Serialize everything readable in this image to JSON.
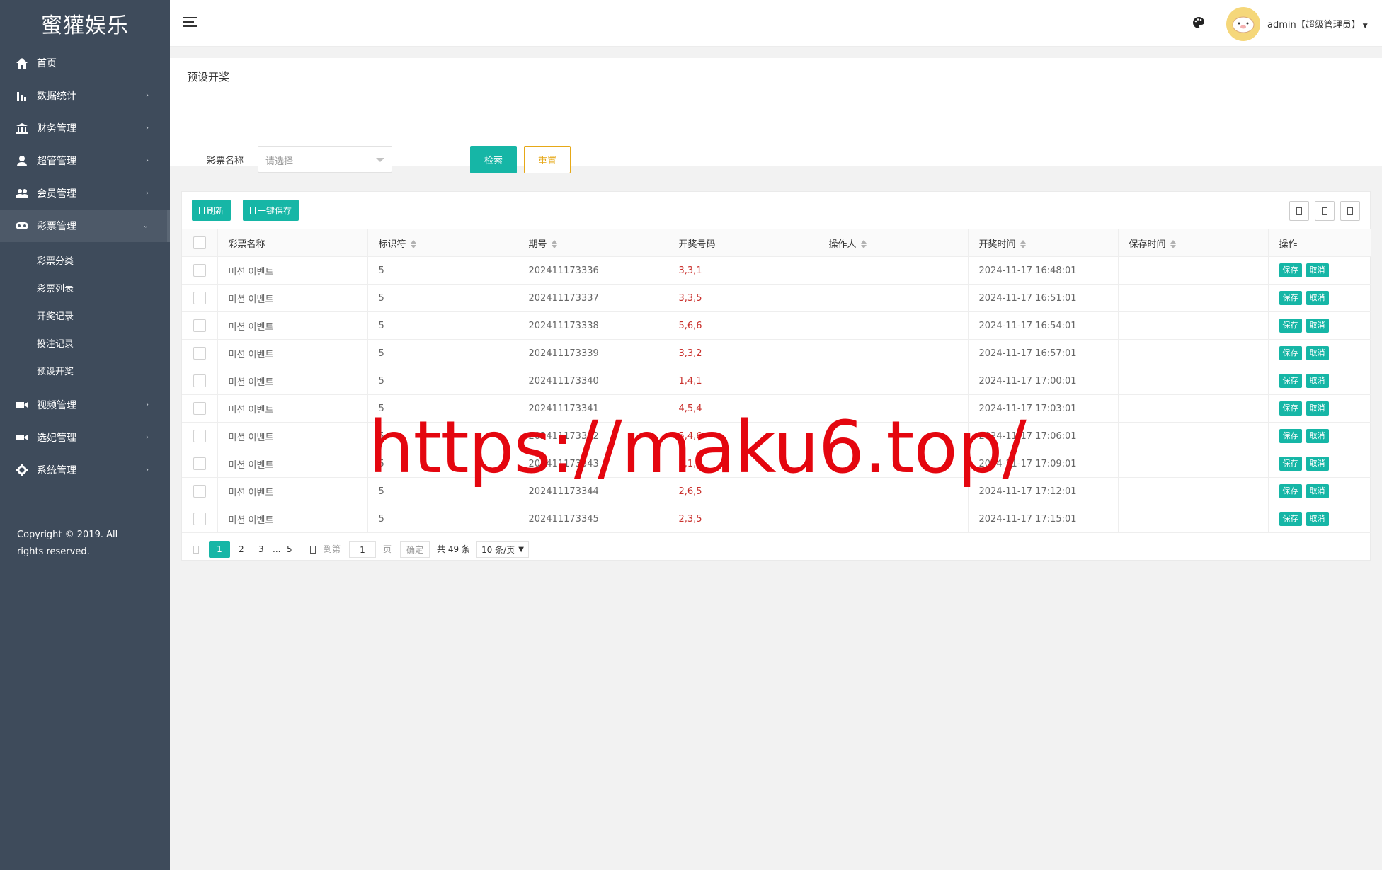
{
  "app": {
    "title": "蜜獾娱乐"
  },
  "sidebar": {
    "items": [
      {
        "label": "首页",
        "icon": "home-icon",
        "has_children": false
      },
      {
        "label": "数据统计",
        "icon": "bar-chart-icon",
        "has_children": true
      },
      {
        "label": "财务管理",
        "icon": "bank-icon",
        "has_children": true
      },
      {
        "label": "超管管理",
        "icon": "user-icon",
        "has_children": true
      },
      {
        "label": "会员管理",
        "icon": "users-icon",
        "has_children": true
      },
      {
        "label": "彩票管理",
        "icon": "gamepad-icon",
        "has_children": true,
        "active": true
      }
    ],
    "sub_items": [
      "彩票分类",
      "彩票列表",
      "开奖记录",
      "投注记录",
      "预设开奖"
    ],
    "items_after": [
      {
        "label": "视频管理",
        "icon": "video-icon",
        "has_children": true
      },
      {
        "label": "选妃管理",
        "icon": "video-icon",
        "has_children": true
      },
      {
        "label": "系统管理",
        "icon": "gear-icon",
        "has_children": true
      }
    ],
    "copyright": "Copyright © 2019. All rights reserved."
  },
  "header": {
    "user_label": "admin【超级管理员】",
    "icons": [
      "menu-icon",
      "palette-icon"
    ]
  },
  "search": {
    "title": "预设开奖",
    "field_label": "彩票名称",
    "select_placeholder": "请选择",
    "search_button": "检索",
    "reset_button": "重置"
  },
  "toolbar": {
    "refresh_label": "刷新",
    "save_all_label": "一键保存"
  },
  "table": {
    "columns": [
      "彩票名称",
      "标识符",
      "期号",
      "开奖号码",
      "操作人",
      "开奖时间",
      "保存时间",
      "操作"
    ],
    "sortable": [
      false,
      true,
      true,
      false,
      true,
      true,
      true,
      false
    ],
    "rows": [
      {
        "name": "미션 이벤트",
        "key": "5",
        "issue": "202411173336",
        "numbers": "3,3,1",
        "operator": "",
        "draw_time": "2024-11-17 16:48:01",
        "save_time": ""
      },
      {
        "name": "미션 이벤트",
        "key": "5",
        "issue": "202411173337",
        "numbers": "3,3,5",
        "operator": "",
        "draw_time": "2024-11-17 16:51:01",
        "save_time": ""
      },
      {
        "name": "미션 이벤트",
        "key": "5",
        "issue": "202411173338",
        "numbers": "5,6,6",
        "operator": "",
        "draw_time": "2024-11-17 16:54:01",
        "save_time": ""
      },
      {
        "name": "미션 이벤트",
        "key": "5",
        "issue": "202411173339",
        "numbers": "3,3,2",
        "operator": "",
        "draw_time": "2024-11-17 16:57:01",
        "save_time": ""
      },
      {
        "name": "미션 이벤트",
        "key": "5",
        "issue": "202411173340",
        "numbers": "1,4,1",
        "operator": "",
        "draw_time": "2024-11-17 17:00:01",
        "save_time": ""
      },
      {
        "name": "미션 이벤트",
        "key": "5",
        "issue": "202411173341",
        "numbers": "4,5,4",
        "operator": "",
        "draw_time": "2024-11-17 17:03:01",
        "save_time": ""
      },
      {
        "name": "미션 이벤트",
        "key": "5",
        "issue": "202411173342",
        "numbers": "5,4,6",
        "operator": "",
        "draw_time": "2024-11-17 17:06:01",
        "save_time": ""
      },
      {
        "name": "미션 이벤트",
        "key": "5",
        "issue": "202411173343",
        "numbers": "2,1,1",
        "operator": "",
        "draw_time": "2024-11-17 17:09:01",
        "save_time": ""
      },
      {
        "name": "미션 이벤트",
        "key": "5",
        "issue": "202411173344",
        "numbers": "2,6,5",
        "operator": "",
        "draw_time": "2024-11-17 17:12:01",
        "save_time": ""
      },
      {
        "name": "미션 이벤트",
        "key": "5",
        "issue": "202411173345",
        "numbers": "2,3,5",
        "operator": "",
        "draw_time": "2024-11-17 17:15:01",
        "save_time": ""
      }
    ],
    "row_actions": {
      "save": "保存",
      "cancel": "取消"
    }
  },
  "pagination": {
    "current": "1",
    "pages": [
      "2",
      "3"
    ],
    "ellipsis": "...",
    "last": "5",
    "goto_label": "到第",
    "goto_value": "1",
    "page_unit": "页",
    "confirm": "确定",
    "total": "共 49 条",
    "page_size": "10 条/页"
  },
  "watermark": "https://maku6.top/",
  "colors": {
    "sidebar_bg": "#3e4b5b",
    "accent": "#16b6a6",
    "reset": "#e6a817",
    "number_red": "#c9302c",
    "watermark": "#e4060f"
  }
}
